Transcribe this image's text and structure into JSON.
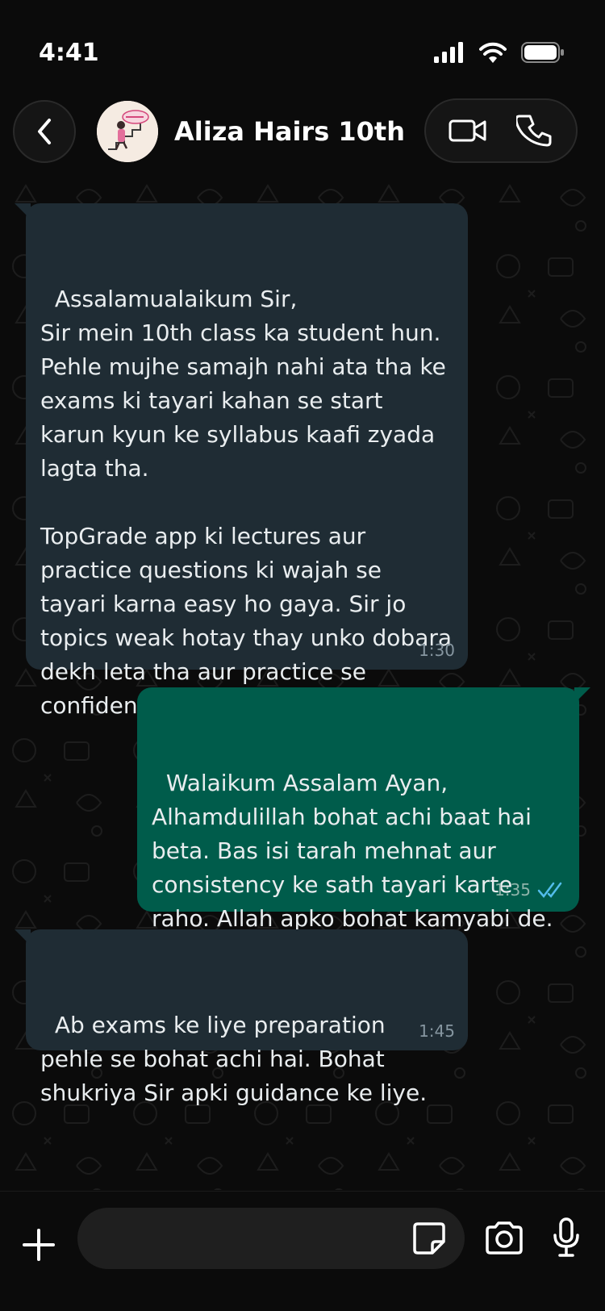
{
  "status_bar": {
    "time": "4:41",
    "icons": [
      "cellular-signal-icon",
      "wifi-icon",
      "battery-icon"
    ]
  },
  "header": {
    "back_icon": "chevron-left-icon",
    "contact_name": "Aliza Hairs 10th",
    "avatar_icon": "contact-avatar",
    "video_icon": "video-call-icon",
    "phone_icon": "voice-call-icon"
  },
  "messages": [
    {
      "direction": "incoming",
      "text": "Assalamualaikum Sir,\nSir mein 10th class ka student hun. Pehle mujhe samajh nahi ata tha ke exams ki tayari kahan se start karun kyun ke syllabus kaafi zyada lagta tha.\n\nTopGrade app ki lectures aur practice questions ki wajah se tayari karna easy ho gaya. Sir jo topics weak hotay thay unko dobara dekh leta tha aur practice se confidence bhi aa gaya.",
      "time": "1:30"
    },
    {
      "direction": "outgoing",
      "text": "Walaikum Assalam Ayan,\nAlhamdulillah bohat achi baat hai beta. Bas isi tarah mehnat aur consistency ke sath tayari karte raho. Allah apko bohat kamyabi de.",
      "time": "1:35",
      "status": "read"
    },
    {
      "direction": "incoming",
      "text": "Ab exams ke liye preparation pehle se bohat achi hai. Bohat shukriya Sir apki guidance ke liye.",
      "time": "1:45"
    }
  ],
  "input_bar": {
    "plus_icon": "plus-icon",
    "placeholder": "",
    "sticker_icon": "sticker-icon",
    "camera_icon": "camera-icon",
    "mic_icon": "microphone-icon"
  },
  "colors": {
    "background": "#0b0b0b",
    "incoming_bubble": "#1f2c34",
    "outgoing_bubble": "#005c4b",
    "read_ticks": "#53bdeb",
    "timestamp": "#8696a0"
  }
}
